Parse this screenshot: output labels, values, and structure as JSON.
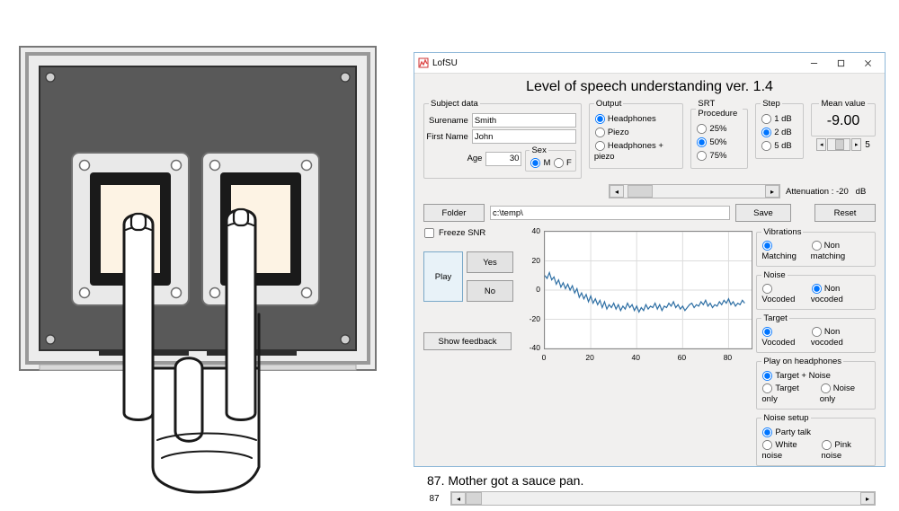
{
  "window": {
    "title": "LofSU",
    "heading": "Level of speech understanding ver. 1.4"
  },
  "subject": {
    "legend": "Subject data",
    "surename_lbl": "Surename",
    "surename": "Smith",
    "firstname_lbl": "First Name",
    "firstname": "John",
    "age_lbl": "Age",
    "age": "30",
    "sex_legend": "Sex",
    "sex_m": "M",
    "sex_f": "F"
  },
  "output": {
    "legend": "Output",
    "opt1": "Headphones",
    "opt2": "Piezo",
    "opt3": "Headphones + piezo"
  },
  "srt": {
    "legend": "SRT Procedure",
    "opt25": "25%",
    "opt50": "50%",
    "opt75": "75%"
  },
  "step": {
    "legend": "Step",
    "opt1": "1 dB",
    "opt2": "2 dB",
    "opt5": "5 dB"
  },
  "mean": {
    "legend": "Mean value",
    "value": "-9.00",
    "sideval": "5"
  },
  "attenuation": {
    "label": "Attenuation :",
    "value": "-20",
    "unit": "dB"
  },
  "folder": {
    "btn": "Folder",
    "path": "c:\\temp\\",
    "save": "Save",
    "reset": "Reset"
  },
  "controls": {
    "freeze": "Freeze SNR",
    "play": "Play",
    "yes": "Yes",
    "no": "No",
    "showfb": "Show feedback"
  },
  "vib": {
    "legend": "Vibrations",
    "opt1": "Matching",
    "opt2": "Non matching"
  },
  "noise": {
    "legend": "Noise",
    "opt1": "Vocoded",
    "opt2": "Non vocoded"
  },
  "target": {
    "legend": "Target",
    "opt1": "Vocoded",
    "opt2": "Non vocoded"
  },
  "poh": {
    "legend": "Play on headphones",
    "opt1": "Target + Noise",
    "opt2": "Target only",
    "opt3": "Noise only"
  },
  "nsetup": {
    "legend": "Noise setup",
    "opt1": "Party talk",
    "opt2": "White noise",
    "opt3": "Pink noise"
  },
  "sentence": "87. Mother got a sauce pan.",
  "counter": "87",
  "chart_data": {
    "type": "line",
    "title": "",
    "xlabel": "",
    "ylabel": "",
    "xlim": [
      0,
      90
    ],
    "ylim": [
      -40,
      40
    ],
    "yticks": [
      40,
      20,
      0,
      -20,
      -40
    ],
    "xticks": [
      0,
      20,
      40,
      60,
      80
    ],
    "x": [
      0,
      1,
      2,
      3,
      4,
      5,
      6,
      7,
      8,
      9,
      10,
      11,
      12,
      13,
      14,
      15,
      16,
      17,
      18,
      19,
      20,
      21,
      22,
      23,
      24,
      25,
      26,
      27,
      28,
      29,
      30,
      31,
      32,
      33,
      34,
      35,
      36,
      37,
      38,
      39,
      40,
      41,
      42,
      43,
      44,
      45,
      46,
      47,
      48,
      49,
      50,
      51,
      52,
      53,
      54,
      55,
      56,
      57,
      58,
      59,
      60,
      61,
      62,
      63,
      64,
      65,
      66,
      67,
      68,
      69,
      70,
      71,
      72,
      73,
      74,
      75,
      76,
      77,
      78,
      79,
      80,
      81,
      82,
      83,
      84,
      85,
      86,
      87
    ],
    "values": [
      10,
      8,
      12,
      7,
      9,
      4,
      7,
      2,
      5,
      1,
      4,
      0,
      3,
      -2,
      1,
      -5,
      -2,
      -6,
      -3,
      -8,
      -4,
      -9,
      -6,
      -10,
      -7,
      -12,
      -8,
      -13,
      -10,
      -12,
      -9,
      -13,
      -10,
      -14,
      -11,
      -13,
      -9,
      -12,
      -10,
      -14,
      -11,
      -15,
      -12,
      -14,
      -10,
      -13,
      -11,
      -12,
      -9,
      -13,
      -10,
      -14,
      -11,
      -12,
      -9,
      -11,
      -8,
      -12,
      -10,
      -13,
      -11,
      -14,
      -12,
      -10,
      -9,
      -12,
      -10,
      -11,
      -8,
      -10,
      -7,
      -11,
      -9,
      -12,
      -10,
      -11,
      -8,
      -10,
      -7,
      -9,
      -6,
      -10,
      -8,
      -11,
      -9,
      -10,
      -7,
      -9
    ]
  }
}
